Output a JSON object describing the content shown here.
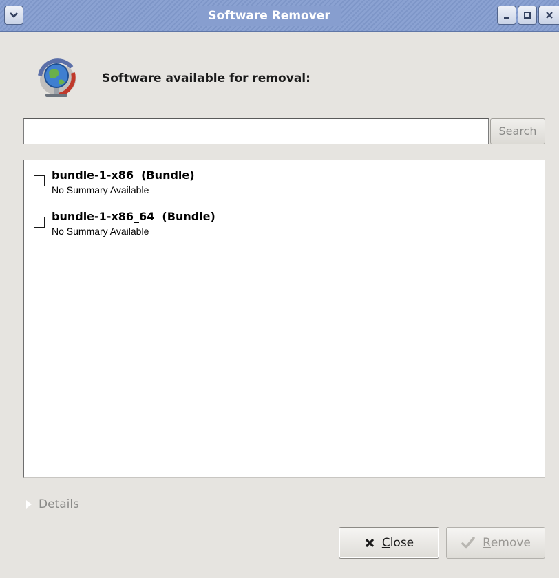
{
  "window": {
    "title": "Software Remover"
  },
  "header": {
    "label": "Software available for removal:",
    "icon": "globe-network-icon"
  },
  "search": {
    "value": "",
    "placeholder": "",
    "button_label_mnemonic": "S",
    "button_label_rest": "earch"
  },
  "packages": [
    {
      "name": "bundle-1-x86  (Bundle)",
      "summary": "No Summary Available",
      "checked": false
    },
    {
      "name": "bundle-1-x86_64  (Bundle)",
      "summary": "No Summary Available",
      "checked": false
    }
  ],
  "details": {
    "label_mnemonic": "D",
    "label_rest": "etails"
  },
  "buttons": {
    "close_mnemonic": "C",
    "close_rest": "lose",
    "remove_mnemonic": "R",
    "remove_rest": "emove"
  },
  "colors": {
    "titlebar": "#879ecf",
    "window_bg": "#e6e4e0",
    "disabled_text": "#8a8a88"
  }
}
